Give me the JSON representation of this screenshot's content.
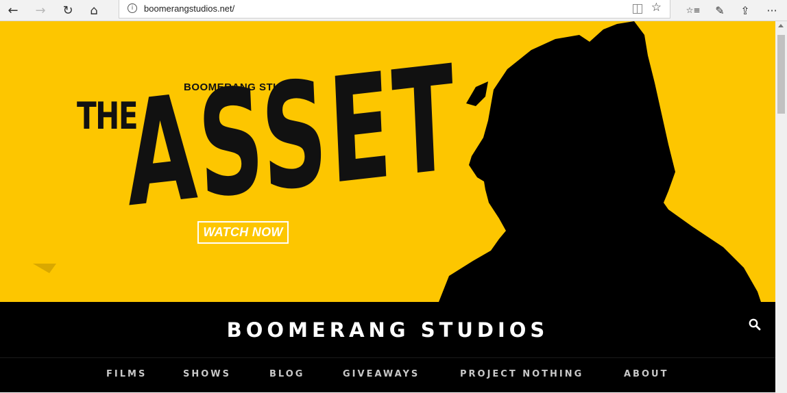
{
  "browser": {
    "url": "boomerangstudios.net/",
    "back_icon": "←",
    "forward_icon": "→",
    "refresh_icon": "↻",
    "home_icon": "⌂",
    "info_icon": "i",
    "star_icon": "☆",
    "favorites_icon": "☆≡",
    "pen_icon": "✎",
    "share_icon": "⇪",
    "more_icon": "···"
  },
  "hero": {
    "studio_name": "BOOMERANG STUDIOS",
    "title_small": "THE",
    "title_large": "ASSET",
    "cta_label": "WATCH NOW",
    "background_color": "#fdc600"
  },
  "site": {
    "brand": "BOOMERANG STUDIOS",
    "menu": [
      {
        "label": "FILMS"
      },
      {
        "label": "SHOWS"
      },
      {
        "label": "BLOG"
      },
      {
        "label": "GIVEAWAYS"
      },
      {
        "label": "PROJECT NOTHING"
      },
      {
        "label": "ABOUT"
      }
    ]
  }
}
